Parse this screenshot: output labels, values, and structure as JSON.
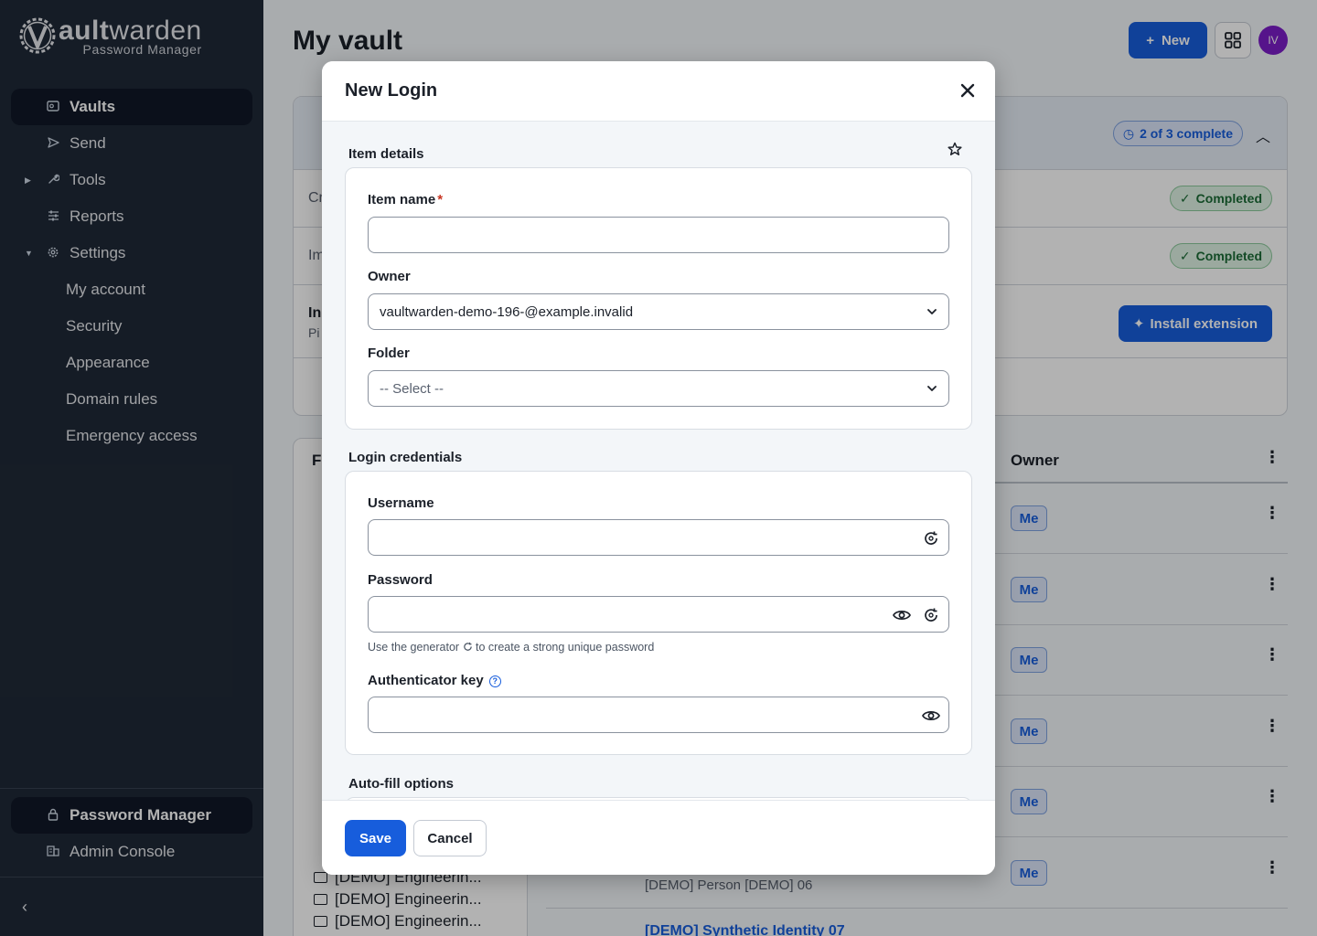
{
  "brand": {
    "name_prefix": "V",
    "name_bold": "ault",
    "name_rest": "warden",
    "subtitle": "Password Manager"
  },
  "sidebar": {
    "items": [
      {
        "label": "Vaults",
        "icon": "vault-icon"
      },
      {
        "label": "Send",
        "icon": "send-icon"
      },
      {
        "label": "Tools",
        "icon": "wrench-icon"
      },
      {
        "label": "Reports",
        "icon": "sliders-icon"
      },
      {
        "label": "Settings",
        "icon": "gear-icon"
      }
    ],
    "settings_sub": [
      "My account",
      "Security",
      "Appearance",
      "Domain rules",
      "Emergency access"
    ],
    "products": [
      {
        "label": "Password Manager",
        "icon": "lock-icon"
      },
      {
        "label": "Admin Console",
        "icon": "building-icon"
      }
    ]
  },
  "header": {
    "title": "My vault",
    "new_button": "New",
    "avatar_initials": "IV"
  },
  "onboarding": {
    "progress": "2 of 3 complete",
    "row_stubs": [
      "Cr",
      "Im",
      "In",
      "Pi"
    ],
    "completed_label": "Completed",
    "install_button": "Install extension"
  },
  "table": {
    "owner_header": "Owner",
    "owner_badge": "Me",
    "visible_subtitle": "[DEMO] Person [DEMO] 06",
    "visible_link": "[DEMO] Synthetic Identity 07"
  },
  "folders": [
    "[DEMO] Engineerin...",
    "[DEMO] Engineerin...",
    "[DEMO] Engineerin..."
  ],
  "filters_stub": "Fi",
  "dialog": {
    "title": "New Login",
    "item_details_label": "Item details",
    "item_name_label": "Item name",
    "item_name_value": "",
    "owner_label": "Owner",
    "owner_value": "vaultwarden-demo-196-@example.invalid",
    "folder_label": "Folder",
    "folder_value": "-- Select --",
    "credentials_label": "Login credentials",
    "username_label": "Username",
    "username_value": "",
    "password_label": "Password",
    "password_value": "",
    "password_hint_before": "Use the generator",
    "password_hint_after": "to create a strong unique password",
    "auth_key_label": "Authenticator key",
    "auth_key_value": "",
    "autofill_label": "Auto-fill options",
    "save_button": "Save",
    "cancel_button": "Cancel"
  },
  "colors": {
    "primary": "#175ddc",
    "sidebar_bg": "#1f2937",
    "success": "#1b6b36",
    "avatar": "#7c1ec7"
  }
}
